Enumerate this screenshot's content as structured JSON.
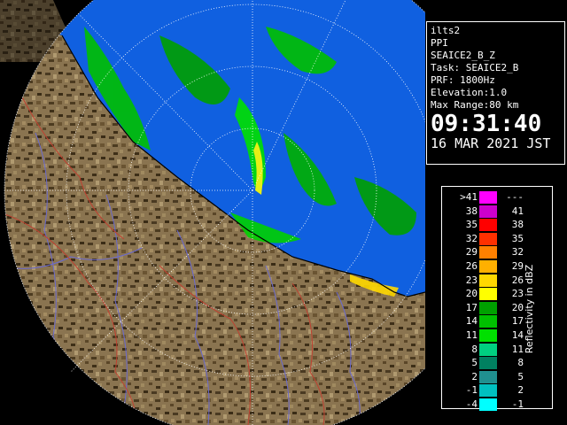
{
  "info": {
    "site": "ilts2",
    "product": "PPI",
    "config": "SEAICE2_B_Z",
    "task": "Task: SEAICE2_B",
    "prf": "PRF: 1800Hz",
    "elevation": "Elevation:1.0",
    "max_range": "Max Range:80 km",
    "time": "09:31:40",
    "date": "16 MAR 2021 JST"
  },
  "legend": {
    "title": "Reflectivity in dBZ",
    "rows": [
      {
        "left": ">41",
        "right": "---",
        "color": "#ff00ff"
      },
      {
        "left": "38",
        "right": "41",
        "color": "#cc00cc"
      },
      {
        "left": "35",
        "right": "38",
        "color": "#ff0000"
      },
      {
        "left": "32",
        "right": "35",
        "color": "#ff3000"
      },
      {
        "left": "29",
        "right": "32",
        "color": "#ff8000"
      },
      {
        "left": "26",
        "right": "29",
        "color": "#ffb000"
      },
      {
        "left": "23",
        "right": "26",
        "color": "#ffd800"
      },
      {
        "left": "20",
        "right": "23",
        "color": "#ffff00"
      },
      {
        "left": "17",
        "right": "20",
        "color": "#00a000"
      },
      {
        "left": "14",
        "right": "17",
        "color": "#00c000"
      },
      {
        "left": "11",
        "right": "14",
        "color": "#00e000"
      },
      {
        "left": "8",
        "right": "11",
        "color": "#00d080"
      },
      {
        "left": "5",
        "right": "8",
        "color": "#008060"
      },
      {
        "left": "2",
        "right": "5",
        "color": "#209090"
      },
      {
        "left": "-1",
        "right": "2",
        "color": "#00c0c0"
      },
      {
        "left": "-4",
        "right": "-1",
        "color": "#00ffff"
      }
    ]
  },
  "colors": {
    "background": "#000000",
    "sea_echo": "#1060e0",
    "land": "#8a7450",
    "land_shadow": "#4a3a22",
    "rivers": "#6a6ad0",
    "borders": "#c04030",
    "range_rings": "#ffffff"
  }
}
